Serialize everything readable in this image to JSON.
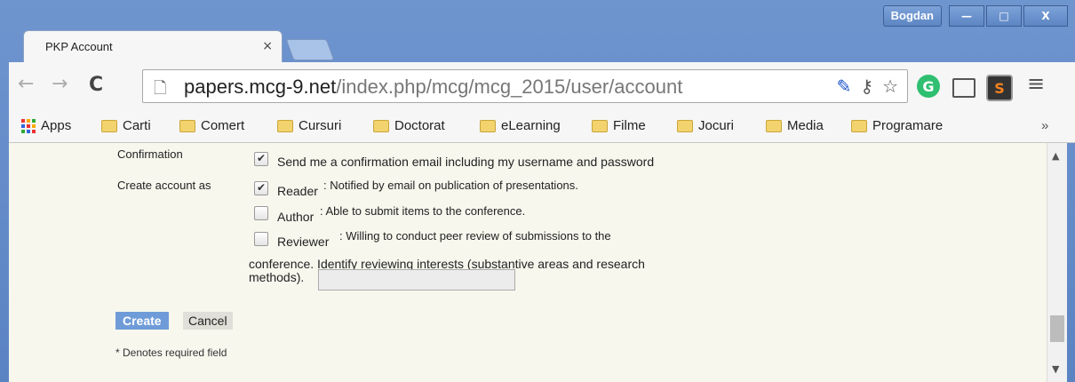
{
  "window": {
    "user": "Bogdan",
    "controls": {
      "minimize": "—",
      "maximize": "□",
      "close": "X"
    }
  },
  "tab": {
    "title": "PKP Account",
    "close": "×"
  },
  "toolbar": {
    "back": "←",
    "forward": "→",
    "reload": "C",
    "url_host": "papers.mcg-9.net",
    "url_path": "/index.php/mcg/mcg_2015/user/account",
    "page_icon": "page-icon",
    "key_icon": "key-icon",
    "star_icon": "star-icon",
    "menu": "≡"
  },
  "bookmarks": {
    "apps": "Apps",
    "items": [
      "Carti",
      "Comert",
      "Cursuri",
      "Doctorat",
      "eLearning",
      "Filme",
      "Jocuri",
      "Media",
      "Programare"
    ],
    "more": "»"
  },
  "form": {
    "confirmation_label": "Confirmation",
    "confirmation_text": "Send me a confirmation email including my username and password",
    "confirmation_checked": true,
    "create_account_label": "Create account as",
    "roles": [
      {
        "name": "Reader",
        "desc": ": Notified by email on publication of presentations.",
        "checked": true
      },
      {
        "name": "Author",
        "desc": ": Able to submit items to the conference.",
        "checked": false
      },
      {
        "name": "Reviewer",
        "desc": ": Willing to conduct peer review of submissions to the",
        "checked": false
      }
    ],
    "reviewer_desc_cont": "conference. Identify reviewing interests (substantive areas and research",
    "reviewer_desc_end": "methods).",
    "interests_value": "",
    "create_button": "Create",
    "cancel_button": "Cancel",
    "required_note": "* Denotes required field"
  }
}
